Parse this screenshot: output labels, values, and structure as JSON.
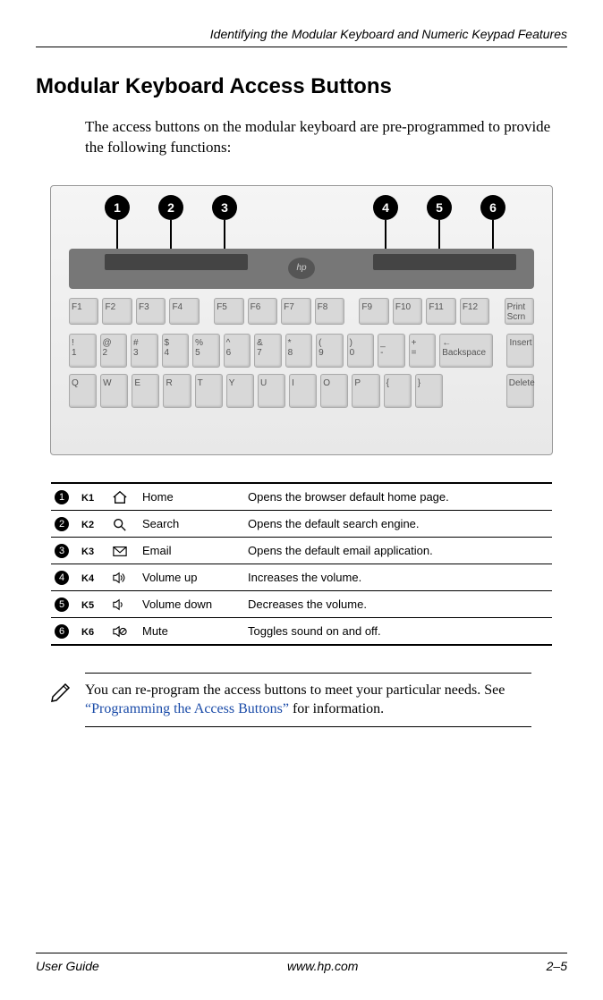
{
  "running_header": "Identifying the Modular Keyboard and Numeric Keypad Features",
  "section_title": "Modular Keyboard Access Buttons",
  "intro_text": "The access buttons on the modular keyboard are pre-programmed to provide the following functions:",
  "figure": {
    "callouts": [
      "1",
      "2",
      "3",
      "4",
      "5",
      "6"
    ],
    "logo": "hp",
    "f_row": [
      "F1",
      "F2",
      "F3",
      "F4",
      "F5",
      "F6",
      "F7",
      "F8",
      "F9",
      "F10",
      "F11",
      "F12",
      "Print Scrn"
    ],
    "num_row_top": [
      "!",
      "@",
      "#",
      "$",
      "%",
      "^",
      "&",
      "*",
      "(",
      ")",
      "_",
      "+"
    ],
    "num_row_bot": [
      "1",
      "2",
      "3",
      "4",
      "5",
      "6",
      "7",
      "8",
      "9",
      "0",
      "-",
      "=",
      "← Backspace",
      "Insert"
    ],
    "q_row": [
      "Q",
      "W",
      "E",
      "R",
      "T",
      "Y",
      "U",
      "I",
      "O",
      "P",
      "{",
      "}",
      "Delete"
    ]
  },
  "buttons_table": [
    {
      "num": "1",
      "code": "K1",
      "icon": "home",
      "name": "Home",
      "desc": "Opens the browser default home page."
    },
    {
      "num": "2",
      "code": "K2",
      "icon": "search",
      "name": "Search",
      "desc": "Opens the default search engine."
    },
    {
      "num": "3",
      "code": "K3",
      "icon": "email",
      "name": "Email",
      "desc": "Opens the default email application."
    },
    {
      "num": "4",
      "code": "K4",
      "icon": "vol-up",
      "name": "Volume up",
      "desc": "Increases the volume."
    },
    {
      "num": "5",
      "code": "K5",
      "icon": "vol-down",
      "name": "Volume down",
      "desc": "Decreases the volume."
    },
    {
      "num": "6",
      "code": "K6",
      "icon": "mute",
      "name": "Mute",
      "desc": "Toggles sound on and off."
    }
  ],
  "note": {
    "pre_text": "You can re-program the access buttons to meet your particular needs. See ",
    "link_text": "“Programming the Access Buttons”",
    "post_text": " for information."
  },
  "footer": {
    "left": "User Guide",
    "center": "www.hp.com",
    "right": "2–5"
  }
}
